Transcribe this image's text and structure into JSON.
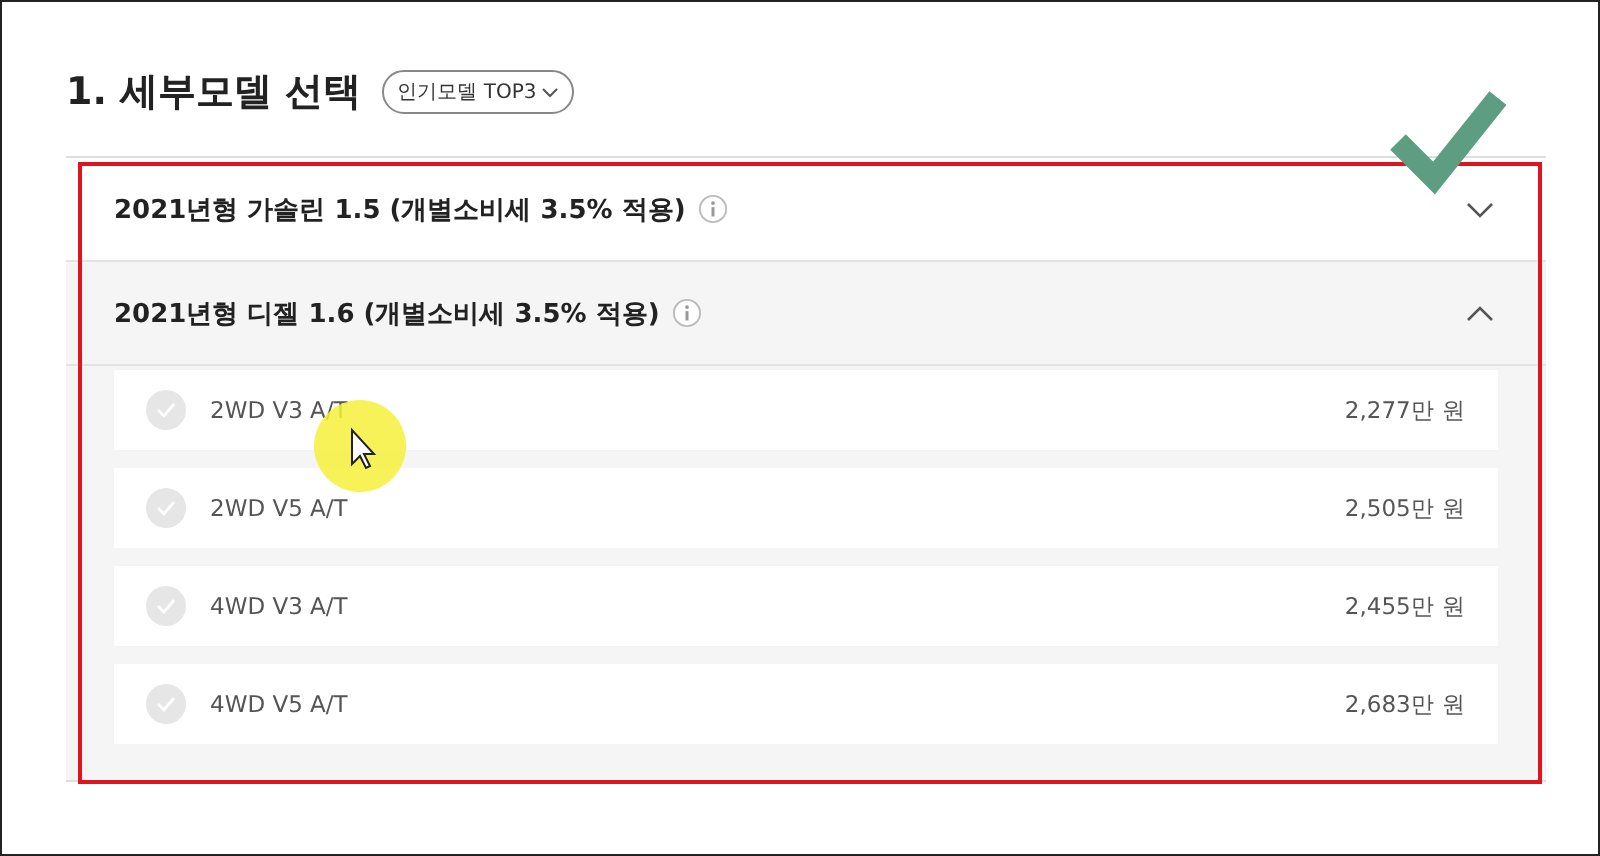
{
  "title": "1. 세부모델 선택",
  "filter_button": {
    "label": "인기모델 TOP3"
  },
  "sections": [
    {
      "label": "2021년형 가솔린 1.5 (개별소비세 3.5% 적용)",
      "expanded": false
    },
    {
      "label": "2021년형 디젤 1.6 (개별소비세 3.5% 적용)",
      "expanded": true,
      "models": [
        {
          "name": "2WD V3 A/T",
          "price": "2,277만 원",
          "selected": false
        },
        {
          "name": "2WD V5 A/T",
          "price": "2,505만 원",
          "selected": false
        },
        {
          "name": "4WD V3 A/T",
          "price": "2,455만 원",
          "selected": false
        },
        {
          "name": "4WD V5 A/T",
          "price": "2,683만 원",
          "selected": false
        }
      ]
    }
  ]
}
